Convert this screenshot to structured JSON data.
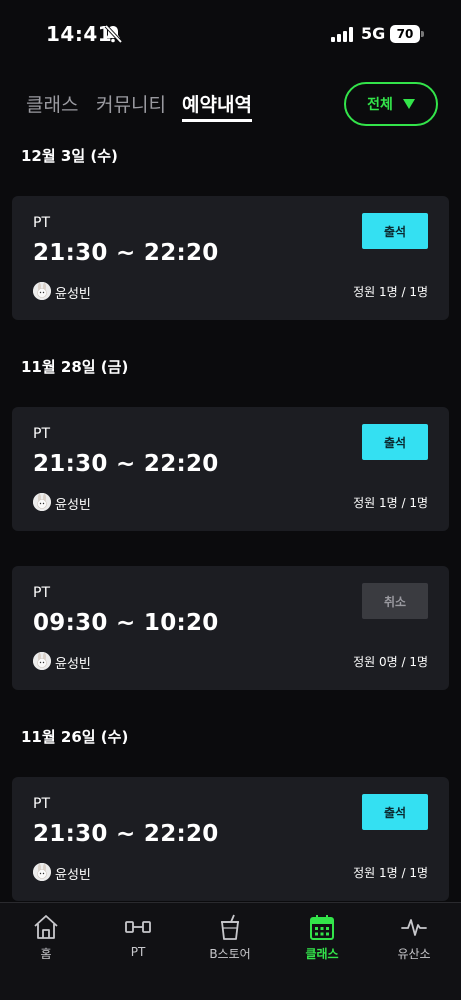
{
  "status_bar": {
    "time": "14:41",
    "network": "5G",
    "battery": "70"
  },
  "tabs": [
    {
      "label": "클래스",
      "active": false
    },
    {
      "label": "커뮤니티",
      "active": false
    },
    {
      "label": "예약내역",
      "active": true
    }
  ],
  "filter": {
    "label": "전체"
  },
  "sections": [
    {
      "date": "12월 3일 (수)",
      "cards": [
        {
          "type": "PT",
          "time": "21:30 ~ 22:20",
          "instructor": "윤성빈",
          "capacity": "정원 1명 / 1명",
          "action": "출석",
          "action_kind": "attend"
        }
      ]
    },
    {
      "date": "11월 28일 (금)",
      "cards": [
        {
          "type": "PT",
          "time": "21:30 ~ 22:20",
          "instructor": "윤성빈",
          "capacity": "정원 1명 / 1명",
          "action": "출석",
          "action_kind": "attend"
        },
        {
          "type": "PT",
          "time": "09:30 ~ 10:20",
          "instructor": "윤성빈",
          "capacity": "정원 0명 / 1명",
          "action": "취소",
          "action_kind": "cancel"
        }
      ]
    },
    {
      "date": "11월 26일 (수)",
      "cards": [
        {
          "type": "PT",
          "time": "21:30 ~ 22:20",
          "instructor": "윤성빈",
          "capacity": "정원 1명 / 1명",
          "action": "출석",
          "action_kind": "attend"
        }
      ]
    }
  ],
  "bottom_nav": [
    {
      "label": "홈",
      "icon": "home-icon",
      "active": false
    },
    {
      "label": "PT",
      "icon": "dumbbell-icon",
      "active": false
    },
    {
      "label": "B스토어",
      "icon": "cup-icon",
      "active": false
    },
    {
      "label": "클래스",
      "icon": "calendar-icon",
      "active": true
    },
    {
      "label": "유산소",
      "icon": "pulse-icon",
      "active": false
    }
  ],
  "colors": {
    "accent_green": "#33e44a",
    "attend_cyan": "#34e0f2",
    "card_bg": "#1c1d22",
    "background": "#0b0b0d"
  }
}
